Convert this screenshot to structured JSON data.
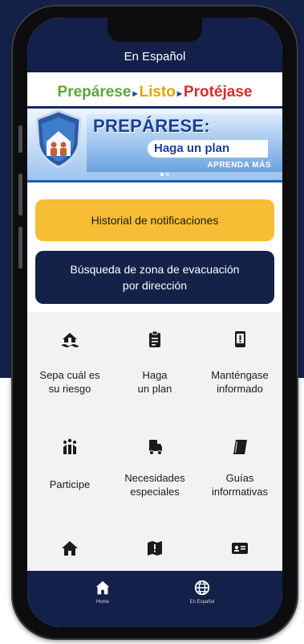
{
  "header": {
    "title": "En Español"
  },
  "banner": {
    "headline": [
      "Prepárese",
      "Listo",
      "Protéjase"
    ],
    "arrow": "▸",
    "slide_title": "PREPÁRESE:",
    "slide_subtitle": "Haga un plan",
    "slide_cta": "APRENDA MÁS",
    "colors": {
      "green": "#58a83a",
      "yellow": "#e3a400",
      "red": "#e02a2a",
      "blue": "#1d3f93"
    }
  },
  "buttons": {
    "history": "Historial de notificaciones",
    "evac_search_line1": "Búsqueda de zona de evacuación",
    "evac_search_line2": "por dirección"
  },
  "grid": {
    "items": [
      {
        "line1": "Sepa cuál es",
        "line2": "su riesgo",
        "icon": "house-flood-icon"
      },
      {
        "line1": "Haga",
        "line2": "un plan",
        "icon": "clipboard-icon"
      },
      {
        "line1": "Manténgase",
        "line2": "informado",
        "icon": "phone-alert-icon"
      },
      {
        "line1": "Participe",
        "line2": "",
        "icon": "people-icon"
      },
      {
        "line1": "Necesidades",
        "line2": "especiales",
        "icon": "truck-icon"
      },
      {
        "line1": "Guías",
        "line2": "informativas",
        "icon": "book-icon"
      },
      {
        "line1": "",
        "line2": "",
        "icon": "home-icon"
      },
      {
        "line1": "",
        "line2": "",
        "icon": "map-alert-icon"
      },
      {
        "line1": "",
        "line2": "",
        "icon": "id-card-icon"
      }
    ]
  },
  "tabbar": {
    "home": "Home",
    "spanish": "En Español"
  },
  "colors": {
    "navy": "#14224a",
    "yellow": "#f7bd34",
    "tile_bg": "#f2f2f4"
  }
}
